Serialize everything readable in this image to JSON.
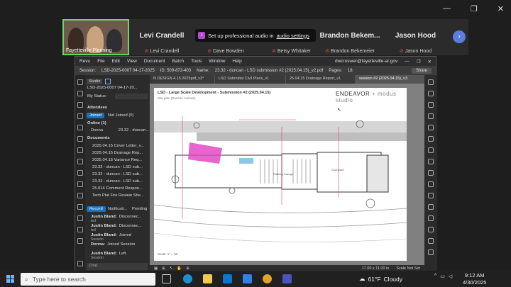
{
  "window_controls": [
    "—",
    "❐",
    "✕"
  ],
  "participants": {
    "video_caption": "Fayetteville Planning",
    "tiles": [
      {
        "name": "Levi Crandell",
        "label": "Levi Crandell"
      },
      {
        "name": "",
        "label": "Dave Bowden"
      },
      {
        "name": "",
        "label": "Betsy Whitaker"
      },
      {
        "name": "Brandon Bekem...",
        "label": "Brandon Bekemeier"
      },
      {
        "name": "Jason Hood",
        "label": "Jason Hood"
      }
    ],
    "audio_banner_prefix": "Set up professional audio in ",
    "audio_banner_link": "audio settings",
    "next_arrow": "›"
  },
  "revu": {
    "menu": [
      "Revu",
      "File",
      "Edit",
      "View",
      "Document",
      "Batch",
      "Tools",
      "Window",
      "Help"
    ],
    "account": "dwcroswer@fayetteville-ar.gov",
    "session": {
      "session_label": "Session:",
      "session_id": "LSD-2025-0007 04-17-2025",
      "id": "ID: 509-872-403",
      "name_label": "Name:",
      "name": "23.32 - duncan - LSD submission #2 (2025.04.15)_v2.pdf",
      "pages_label": "Pages:",
      "pages": "18",
      "share": "Share"
    },
    "panel": {
      "studio": "Studio",
      "session_name": "LSD-2025-0007 04-17-20...",
      "my_status": "My Status:",
      "attendees": "Attendees",
      "joined_tab": "Joined",
      "not_joined_tab": "Not Joined (0)",
      "online": "Online (1)",
      "online_user": "Donna",
      "online_user_meta": "23.32 - duncan...",
      "documents": "Documents",
      "document_list": [
        "2025.04.15 Cover Letter_v...",
        "2025.04.15 Drainage Rep...",
        "2025.04.15 Variance Req...",
        "23.32 - duncan - LSD sub...",
        "23.32 - duncan - LSD sub...",
        "23.32 - duncan - LSD sub...",
        "25.014 Comment Respon...",
        "Tech Plat Fire Review She..."
      ],
      "bottom_tabs": [
        "Record",
        "Notificati...",
        "Pending"
      ],
      "records": [
        {
          "user": "Justin Bland:",
          "action": "Disconnec...",
          "detail": "ted"
        },
        {
          "user": "Justin Bland:",
          "action": "Disconnec...",
          "detail": "ted"
        },
        {
          "user": "Justin Bland:",
          "action": "Joined",
          "detail": "Session"
        },
        {
          "user": "Donna:",
          "action": "Joined Session",
          "detail": ""
        },
        {
          "user": "Justin Bland:",
          "action": "Left",
          "detail": "Session"
        }
      ],
      "chat_placeholder": "Chat"
    },
    "doc_tabs": [
      "N DESIGN 4.15.2025pdf_v3*",
      "LSD Submittal Civil Plans_v1",
      "25.04.15 Drainage Report_v1",
      "session #2 (2025.04.15)_v3"
    ],
    "sheet": {
      "title_prefix": "LSD - Large Scale Development - Submission #2 (2025.04.15)",
      "subtitle": "Site plan (Duncan Avenue)",
      "logo_left": "ENDEAVOR",
      "logo_plus": "+",
      "logo_right": "modus studio",
      "scale_note": "Scale: 1\" = 40'",
      "parking_label": "Parking Garage",
      "courtyard_label": "Courtyard"
    },
    "status": {
      "dims": "17.00 x 11.00 in",
      "scale": "Scale Not Set"
    }
  },
  "taskbar": {
    "search_placeholder": "Type here to search",
    "weather_temp": "61°F",
    "weather_desc": "Cloudy",
    "time": "9:12 AM",
    "date": "4/30/2025",
    "colors": {
      "taskbar": "#202020",
      "edge": "#1f8fd1",
      "explorer": "#f2c94c",
      "chrome": "#e2a22b",
      "teams": "#4b53bc"
    }
  }
}
